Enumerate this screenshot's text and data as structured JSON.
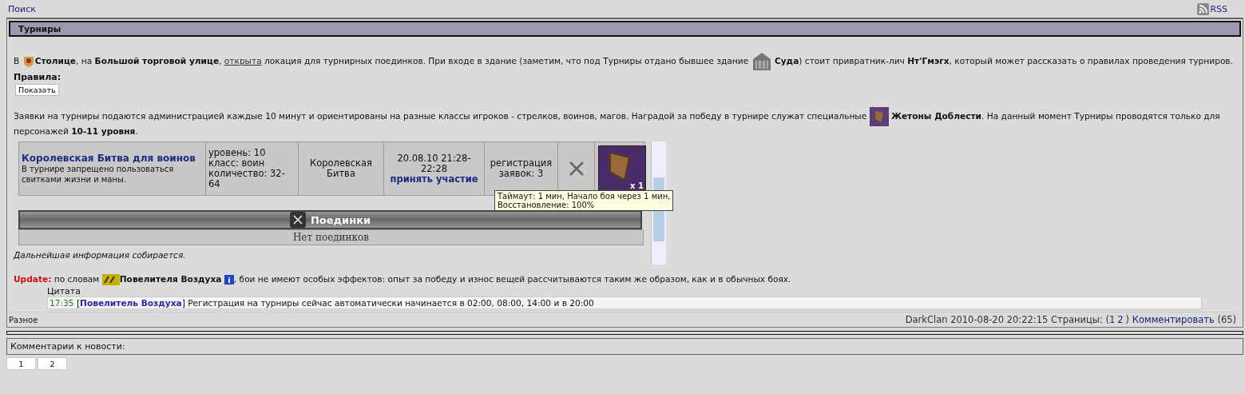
{
  "top_bar": {
    "search_link": "Поиск",
    "rss_link": "RSS"
  },
  "panel": {
    "title": "Турниры",
    "intro": {
      "before": "В ",
      "middle": "**Столице**, на **Большой торговой улице**, ",
      "link": "открыта",
      "after": " локация для турнирных поединков. При входе в здание (заметим, что под Турниры отдано бывшее здание ",
      "end": " **Суда**) стоит привратник-лич **Нт'Гмэгх**, который может рассказать о правилах проведения турниров."
    },
    "rules_label": "Правила:",
    "show_button": "Показать",
    "info": {
      "before": "Заявки на турниры подаются администрацией каждые 10 минут и ориентированы на разные классы игроков - стрелков, воинов, магов. Наградой за победу в турнире служат специальные ",
      "after": " **Жетоны Доблести**. На данный момент Турниры проводятся только для персонажей **10-11 уровня**."
    },
    "tournament": {
      "name": "Королевская Битва для воинов",
      "description": "В турнире запрещено пользоваться свитками жизни и маны.",
      "stats": [
        "уровень: 10",
        "класс: воин",
        "количество: 32-64"
      ],
      "type": "Королевская Битва",
      "time": "20.08.10 21:28-22:28",
      "join_link": "принять участие",
      "registration": "регистрация заявок: 3",
      "reward_count": "x 1",
      "tooltip": [
        "Таймаут: 1 мин, Начало боя через 1 мин,",
        "Восстановление: 100%"
      ]
    },
    "duels_title": "Поединки",
    "duels_empty": "Нет поединков",
    "note": "Дальнейшая информация собирается.",
    "update": {
      "label": "Update:",
      "before": " по словам ",
      "name": "Повелителя Воздуха",
      "after": ", бои не имеют особых эффектов: опыт за победу и износ вещей рассчитываются таким же образом, как и в обычных боях."
    },
    "quote": {
      "label": "Цитата",
      "time": "17:35",
      "open": "[",
      "close": "]",
      "speaker": "Повелитель Воздуха",
      "message": "Регистрация на турниры сейчас автоматически начинается в 02:00, 08:00, 14:00 и в 20:00"
    },
    "category": "Разное",
    "footer": {
      "meta": "DarkClan 2010-08-20 20:22:15 Страницы: (",
      "pages": [
        "1",
        "2"
      ],
      "close": ")",
      "comment_link": "Комментировать",
      "count": "(65)"
    }
  },
  "comments": {
    "title": "Комментарии к новости:",
    "pages": [
      "1",
      "2"
    ]
  }
}
